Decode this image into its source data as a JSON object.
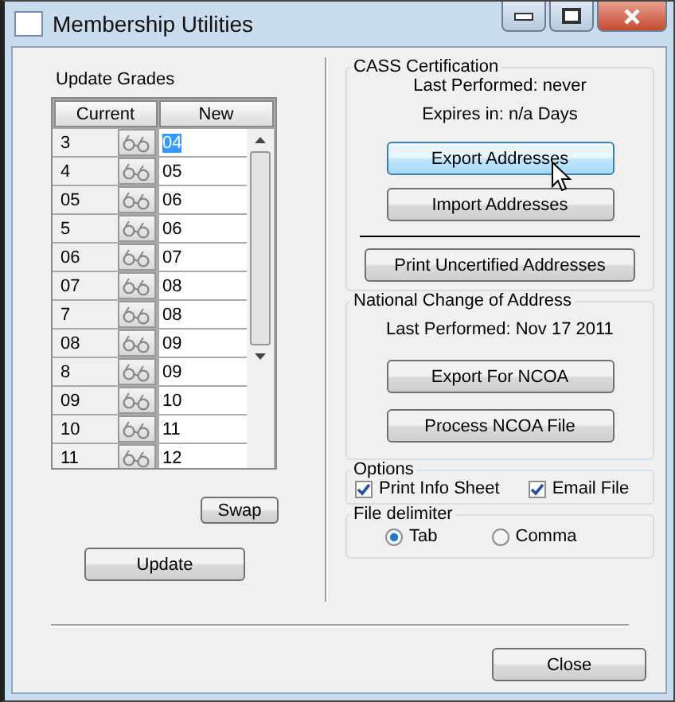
{
  "window": {
    "title": "Membership Utilities"
  },
  "update_grades": {
    "title": "Update Grades",
    "columns": [
      "Current",
      "New"
    ],
    "rows": [
      {
        "current": "3",
        "new": "04",
        "selected": true
      },
      {
        "current": "4",
        "new": "05",
        "selected": false
      },
      {
        "current": "05",
        "new": "06",
        "selected": false
      },
      {
        "current": "5",
        "new": "06",
        "selected": false
      },
      {
        "current": "06",
        "new": "07",
        "selected": false
      },
      {
        "current": "07",
        "new": "08",
        "selected": false
      },
      {
        "current": "7",
        "new": "08",
        "selected": false
      },
      {
        "current": "08",
        "new": "09",
        "selected": false
      },
      {
        "current": "8",
        "new": "09",
        "selected": false
      },
      {
        "current": "09",
        "new": "10",
        "selected": false
      },
      {
        "current": "10",
        "new": "11",
        "selected": false
      },
      {
        "current": "11",
        "new": "12",
        "selected": false
      }
    ],
    "swap_button": "Swap",
    "update_button": "Update"
  },
  "cass": {
    "title": "CASS Certification",
    "last_performed": "Last Performed: never",
    "expires": "Expires in: n/a Days",
    "buttons": [
      {
        "label": "Export Addresses",
        "hovered": true
      },
      {
        "label": "Import Addresses",
        "hovered": false
      }
    ],
    "print_button": "Print Uncertified Addresses"
  },
  "ncoa": {
    "title": "National Change of Address",
    "last_performed": "Last Performed: Nov 17 2011",
    "buttons": [
      {
        "label": "Export For NCOA",
        "hovered": false
      },
      {
        "label": "Process NCOA File",
        "hovered": false
      }
    ]
  },
  "options": {
    "title": "Options",
    "checkboxes": [
      {
        "label": "Print Info Sheet",
        "checked": true
      },
      {
        "label": "Email File",
        "checked": true
      }
    ]
  },
  "file_delimiter": {
    "title": "File delimiter",
    "radios": [
      {
        "label": "Tab",
        "selected": true
      },
      {
        "label": "Comma",
        "selected": false
      }
    ]
  },
  "close_button": "Close"
}
